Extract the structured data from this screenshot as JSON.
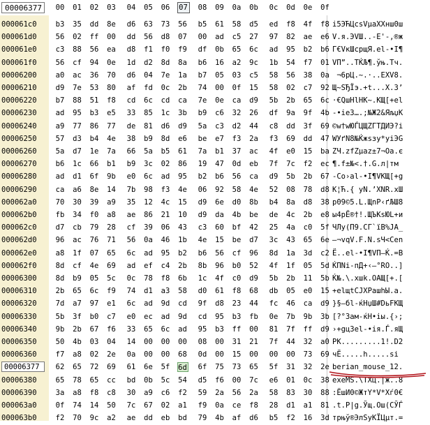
{
  "header": {
    "address": "00006377",
    "columns": [
      "00",
      "01",
      "02",
      "03",
      "04",
      "05",
      "06",
      "07",
      "08",
      "09",
      "0a",
      "0b",
      "0c",
      "0d",
      "0e",
      "0f"
    ],
    "active_column": 7
  },
  "colors": {
    "address_bg": "#f7f1d2",
    "selected_cell_bg": "#d8eccf",
    "annotation_red": "#b2141b"
  },
  "rows": [
    {
      "addr": "000061c0",
      "hex": [
        "b3",
        "35",
        "dd",
        "8e",
        "d6",
        "63",
        "73",
        "56",
        "b5",
        "61",
        "58",
        "d5",
        "ed",
        "f8",
        "4f",
        "f8"
      ],
      "ascii": "і5ЭЋЦcsVµaXХнш0ш"
    },
    {
      "addr": "000061d0",
      "hex": [
        "56",
        "02",
        "ff",
        "00",
        "dd",
        "56",
        "d8",
        "07",
        "00",
        "ad",
        "c5",
        "27",
        "97",
        "82",
        "ae",
        "e6"
      ],
      "ascii": "V.я.ЭVШ..-Е'-,®ж"
    },
    {
      "addr": "000061e0",
      "hex": [
        "c3",
        "88",
        "56",
        "ea",
        "d8",
        "f1",
        "f0",
        "f9",
        "df",
        "0b",
        "65",
        "6c",
        "ad",
        "95",
        "b2",
        "b6"
      ],
      "ascii": "Г€VкШсрщЯ.el-•І¶"
    },
    {
      "addr": "000061f0",
      "hex": [
        "56",
        "cf",
        "94",
        "0e",
        "1d",
        "d2",
        "8d",
        "8a",
        "b6",
        "16",
        "a2",
        "9c",
        "1b",
        "54",
        "f7",
        "01"
      ],
      "ascii": "VП”..ТЌЉ¶.ўњ.Tч."
    },
    {
      "addr": "00006200",
      "hex": [
        "a0",
        "ac",
        "36",
        "70",
        "d6",
        "04",
        "7e",
        "1a",
        "b7",
        "05",
        "03",
        "c5",
        "58",
        "56",
        "38",
        "0a"
      ],
      "ascii": " ¬6pЦ.~.·..ЕXV8."
    },
    {
      "addr": "00006210",
      "hex": [
        "d9",
        "7e",
        "53",
        "80",
        "af",
        "fd",
        "0c",
        "2b",
        "74",
        "00",
        "0f",
        "15",
        "58",
        "02",
        "c7",
        "92"
      ],
      "ascii": "Щ~SЂЇэ.+t...X.З’"
    },
    {
      "addr": "00006220",
      "hex": [
        "b7",
        "88",
        "51",
        "f8",
        "cd",
        "6c",
        "cd",
        "ca",
        "7e",
        "0e",
        "ca",
        "d9",
        "5b",
        "2b",
        "65",
        "6c"
      ],
      "ascii": "·€QшНlНК~.КЩ[+el"
    },
    {
      "addr": "00006230",
      "hex": [
        "ad",
        "95",
        "b3",
        "e5",
        "33",
        "85",
        "1c",
        "3b",
        "b9",
        "c6",
        "32",
        "26",
        "df",
        "9a",
        "9f",
        "4b"
      ],
      "ascii": "-•іе3….;№Ж2&ЯљџK"
    },
    {
      "addr": "00006240",
      "hex": [
        "a9",
        "77",
        "86",
        "77",
        "de",
        "81",
        "d6",
        "d9",
        "5a",
        "c3",
        "d2",
        "44",
        "c8",
        "dd",
        "3f",
        "69"
      ],
      "ascii": "©w†wЮЃЦЩZГТДИЭ?i"
    },
    {
      "addr": "00006250",
      "hex": [
        "57",
        "d3",
        "b4",
        "4e",
        "38",
        "b9",
        "8d",
        "e6",
        "be",
        "e7",
        "f3",
        "2a",
        "f3",
        "69",
        "dd",
        "47"
      ],
      "ascii": "WУґN8№Ќжѕзу*уiЭG"
    },
    {
      "addr": "00006260",
      "hex": [
        "5a",
        "d7",
        "1e",
        "7a",
        "66",
        "5a",
        "b5",
        "61",
        "7a",
        "b1",
        "37",
        "ac",
        "4f",
        "e0",
        "15",
        "ba"
      ],
      "ascii": "ZЧ.zfZµaz±7¬Oа.є"
    },
    {
      "addr": "00006270",
      "hex": [
        "b6",
        "1c",
        "66",
        "b1",
        "b9",
        "3c",
        "02",
        "86",
        "19",
        "47",
        "0d",
        "eb",
        "7f",
        "7c",
        "f2",
        "ec"
      ],
      "ascii": "¶.f±№<.†.G.л|тм"
    },
    {
      "addr": "00006280",
      "hex": [
        "ad",
        "d1",
        "6f",
        "9b",
        "e0",
        "6c",
        "ad",
        "95",
        "b2",
        "b6",
        "56",
        "ca",
        "d9",
        "5b",
        "2b",
        "67"
      ],
      "ascii": "-Сo›аl-•І¶VКЩ[+g"
    },
    {
      "addr": "00006290",
      "hex": [
        "ca",
        "a6",
        "8e",
        "14",
        "7b",
        "98",
        "f3",
        "4e",
        "06",
        "92",
        "58",
        "4e",
        "52",
        "08",
        "78",
        "d8"
      ],
      "ascii": "К¦Ћ.{ уN.’XNR.xШ"
    },
    {
      "addr": "000062a0",
      "hex": [
        "70",
        "30",
        "39",
        "a9",
        "35",
        "12",
        "4c",
        "15",
        "d9",
        "6e",
        "d0",
        "8b",
        "b4",
        "8a",
        "d8",
        "38"
      ],
      "ascii": "p09©5.L.ЩnР‹ґЉШ8"
    },
    {
      "addr": "000062b0",
      "hex": [
        "fb",
        "34",
        "f0",
        "a8",
        "ae",
        "86",
        "21",
        "10",
        "d9",
        "da",
        "4b",
        "be",
        "de",
        "4c",
        "2b",
        "e8"
      ],
      "ascii": "ы4рЁ®†!.ЩЪKѕЮL+и"
    },
    {
      "addr": "000062c0",
      "hex": [
        "d7",
        "cb",
        "79",
        "28",
        "cf",
        "39",
        "06",
        "43",
        "c3",
        "60",
        "bf",
        "42",
        "25",
        "4a",
        "c0",
        "5f"
      ],
      "ascii": "ЧЛy(П9.CГ`їB%JА_"
    },
    {
      "addr": "000062d0",
      "hex": [
        "96",
        "ac",
        "76",
        "71",
        "56",
        "0a",
        "46",
        "1b",
        "4e",
        "15",
        "be",
        "d7",
        "3c",
        "43",
        "65",
        "6e"
      ],
      "ascii": "–¬vqV.F.N.ѕЧ<Cen"
    },
    {
      "addr": "000062e0",
      "hex": [
        "a8",
        "1f",
        "07",
        "65",
        "6c",
        "ad",
        "95",
        "b2",
        "b6",
        "56",
        "cf",
        "96",
        "8d",
        "1a",
        "3d",
        "c2"
      ],
      "ascii": "Ё..el-•І¶VП–Ќ.=В"
    },
    {
      "addr": "000062f0",
      "hex": [
        "8d",
        "cf",
        "4e",
        "69",
        "ad",
        "ef",
        "c4",
        "2b",
        "8b",
        "96",
        "b0",
        "52",
        "4f",
        "1f",
        "05",
        "5d"
      ],
      "ascii": "ЌПNi-пД+‹–°RO..]"
    },
    {
      "addr": "00006300",
      "hex": [
        "8d",
        "b9",
        "05",
        "5c",
        "0c",
        "78",
        "f8",
        "6b",
        "1c",
        "4f",
        "c0",
        "d9",
        "5b",
        "2b",
        "11",
        "5b"
      ],
      "ascii": "Ќ№.\\.xшk.OАЩ[+.["
    },
    {
      "addr": "00006310",
      "hex": [
        "2b",
        "65",
        "6c",
        "f9",
        "74",
        "d1",
        "a3",
        "58",
        "d0",
        "61",
        "f8",
        "68",
        "db",
        "05",
        "e0",
        "15"
      ],
      "ascii": "+elщtСЈXРaшhЫ.а."
    },
    {
      "addr": "00006320",
      "hex": [
        "7d",
        "a7",
        "97",
        "e1",
        "6c",
        "ad",
        "9d",
        "cd",
        "9f",
        "d8",
        "23",
        "44",
        "fc",
        "46",
        "ca",
        "d9"
      ],
      "ascii": "}§—бl-ќНџШ#DьFКЩ"
    },
    {
      "addr": "00006330",
      "hex": [
        "5b",
        "3f",
        "b0",
        "c7",
        "e0",
        "ec",
        "ad",
        "9d",
        "cd",
        "95",
        "b3",
        "fb",
        "0e",
        "7b",
        "9b",
        "3b"
      ],
      "ascii": "[?°Зам-ќН•іы.{›;"
    },
    {
      "addr": "00006340",
      "hex": [
        "9b",
        "2b",
        "67",
        "f6",
        "33",
        "65",
        "6c",
        "ad",
        "95",
        "b3",
        "ff",
        "00",
        "81",
        "7f",
        "ff",
        "d9"
      ],
      "ascii": "›+gц3el-•ія.Ѓ.яЩ"
    },
    {
      "addr": "00006350",
      "hex": [
        "50",
        "4b",
        "03",
        "04",
        "14",
        "00",
        "00",
        "00",
        "08",
        "00",
        "31",
        "21",
        "7f",
        "44",
        "32",
        "a0"
      ],
      "ascii": "PK.........1!.D2 "
    },
    {
      "addr": "00006360",
      "hex": [
        "f7",
        "a8",
        "02",
        "2e",
        "0a",
        "00",
        "00",
        "68",
        "0d",
        "00",
        "15",
        "00",
        "00",
        "00",
        "73",
        "69"
      ],
      "ascii": "чЁ.....h.....si"
    },
    {
      "addr": "00006377",
      "hex": [
        "62",
        "65",
        "72",
        "69",
        "61",
        "6e",
        "5f",
        "6d",
        "6f",
        "75",
        "73",
        "65",
        "5f",
        "31",
        "32",
        "2e"
      ],
      "ascii": "berian_mouse_12.",
      "current": true,
      "sel": 7
    },
    {
      "addr": "00006380",
      "hex": [
        "65",
        "78",
        "65",
        "cc",
        "bd",
        "0b",
        "5c",
        "54",
        "d5",
        "f6",
        "00",
        "7c",
        "e6",
        "01",
        "0c",
        "38"
      ],
      "ascii": "exeMЅ.\\TХц.|ж..8"
    },
    {
      "addr": "00006390",
      "hex": [
        "3a",
        "a8",
        "f8",
        "c8",
        "30",
        "a9",
        "c6",
        "f2",
        "59",
        "2a",
        "56",
        "2a",
        "58",
        "83",
        "30",
        "88"
      ],
      "ascii": ":ЁшИ0©ЖтY*V*Xѓ0€"
    },
    {
      "addr": "000063a0",
      "hex": [
        "0f",
        "74",
        "14",
        "50",
        "7c",
        "67",
        "02",
        "a1",
        "f9",
        "0a",
        "ce",
        "f8",
        "28",
        "d1",
        "a1",
        "81"
      ],
      "ascii": ".t.P|g.Ўщ.Ош(СЎЃ"
    },
    {
      "addr": "000063b0",
      "hex": [
        "f2",
        "70",
        "9c",
        "a2",
        "ae",
        "dd",
        "eb",
        "bd",
        "79",
        "4b",
        "af",
        "d6",
        "b5",
        "f2",
        "16",
        "3d"
      ],
      "ascii": "трњў®ЭлЅyKЇЦµт.="
    }
  ]
}
